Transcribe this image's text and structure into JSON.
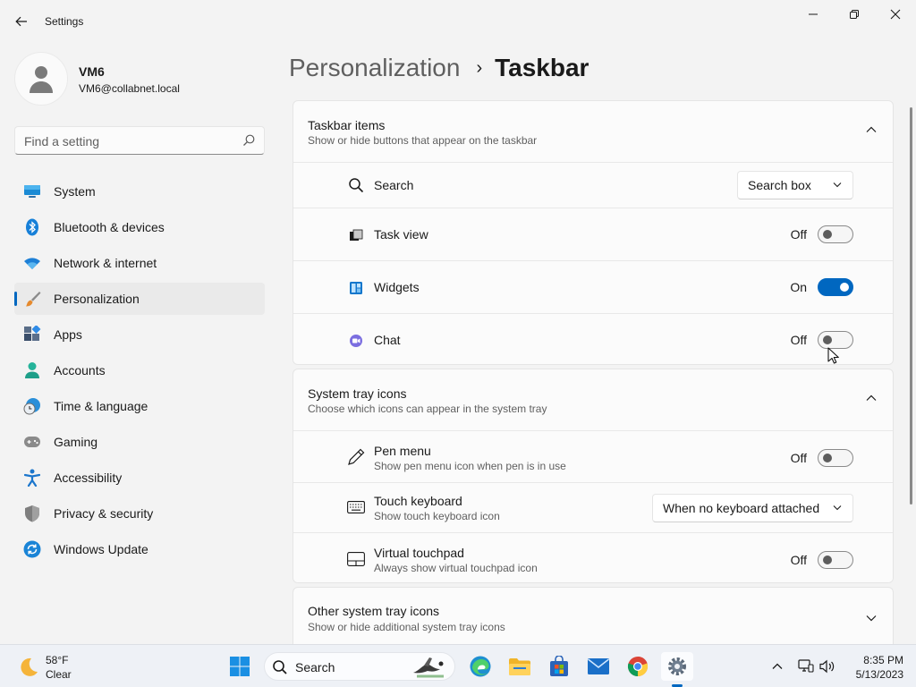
{
  "window": {
    "title": "Settings"
  },
  "profile": {
    "name": "VM6",
    "email": "VM6@collabnet.local"
  },
  "search": {
    "placeholder": "Find a setting"
  },
  "nav": {
    "items": [
      {
        "label": "System",
        "icon": "system-icon"
      },
      {
        "label": "Bluetooth & devices",
        "icon": "bluetooth-icon"
      },
      {
        "label": "Network & internet",
        "icon": "wifi-icon"
      },
      {
        "label": "Personalization",
        "icon": "paintbrush-icon",
        "active": true
      },
      {
        "label": "Apps",
        "icon": "apps-icon"
      },
      {
        "label": "Accounts",
        "icon": "accounts-icon"
      },
      {
        "label": "Time & language",
        "icon": "clock-globe-icon"
      },
      {
        "label": "Gaming",
        "icon": "gamepad-icon"
      },
      {
        "label": "Accessibility",
        "icon": "accessibility-icon"
      },
      {
        "label": "Privacy & security",
        "icon": "shield-icon"
      },
      {
        "label": "Windows Update",
        "icon": "update-icon"
      }
    ]
  },
  "breadcrumb": {
    "parent": "Personalization",
    "separator": "›",
    "current": "Taskbar"
  },
  "taskbar_items": {
    "title": "Taskbar items",
    "subtitle": "Show or hide buttons that appear on the taskbar",
    "rows": {
      "search": {
        "label": "Search",
        "value": "Search box"
      },
      "task_view": {
        "label": "Task view",
        "state": "Off"
      },
      "widgets": {
        "label": "Widgets",
        "state": "On"
      },
      "chat": {
        "label": "Chat",
        "state": "Off"
      }
    }
  },
  "system_tray": {
    "title": "System tray icons",
    "subtitle": "Choose which icons can appear in the system tray",
    "rows": {
      "pen_menu": {
        "label": "Pen menu",
        "sub": "Show pen menu icon when pen is in use",
        "state": "Off"
      },
      "touch_keyboard": {
        "label": "Touch keyboard",
        "sub": "Show touch keyboard icon",
        "value": "When no keyboard attached"
      },
      "virtual_touchpad": {
        "label": "Virtual touchpad",
        "sub": "Always show virtual touchpad icon",
        "state": "Off"
      }
    }
  },
  "other_tray": {
    "title": "Other system tray icons",
    "subtitle": "Show or hide additional system tray icons"
  },
  "taskbar": {
    "weather": {
      "temp": "58°F",
      "condition": "Clear"
    },
    "search_label": "Search",
    "clock": {
      "time": "8:35 PM",
      "date": "5/13/2023"
    }
  },
  "colors": {
    "accent": "#0067c0",
    "background": "#f3f3f3",
    "card": "#fbfbfb"
  }
}
